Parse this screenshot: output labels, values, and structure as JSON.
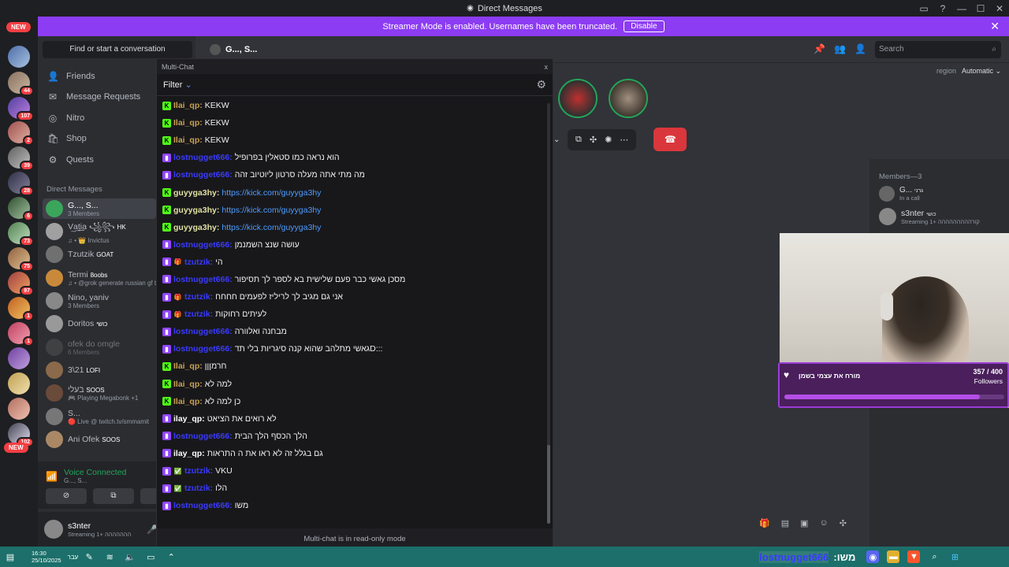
{
  "window": {
    "title": "Direct Messages"
  },
  "banner": {
    "text": "Streamer Mode is enabled. Usernames have been truncated.",
    "button": "Disable"
  },
  "new_badge": "NEW",
  "new_badge_bottom": "NEW",
  "guild_pings": [
    "44",
    "107",
    "2",
    "39",
    "28",
    "6",
    "73",
    "75",
    "97",
    "1",
    "1",
    "102",
    "1"
  ],
  "sidebar": {
    "search": "Find or start a conversation",
    "nav": [
      {
        "label": "Friends",
        "icon": "friends-icon"
      },
      {
        "label": "Message Requests",
        "icon": "envelope-icon"
      },
      {
        "label": "Nitro",
        "icon": "nitro-icon"
      },
      {
        "label": "Shop",
        "icon": "shop-icon"
      },
      {
        "label": "Quests",
        "icon": "quests-icon"
      }
    ],
    "dm_header": "Direct Messages",
    "dms": [
      {
        "name": "G..., S...",
        "sub": "3 Members",
        "color": "#3ba55c"
      },
      {
        "name": "V͢a͢t͢i͢a ꧁꧂",
        "tag": "HK",
        "sub": "♫ • 👑 Invictus",
        "color": "#a0a0a0"
      },
      {
        "name": "Tzutzik",
        "tag": "GOAT",
        "sub": "",
        "color": "#707070"
      },
      {
        "name": "Termi",
        "tag": "8oobs",
        "sub": "♫ • @grok generate russian gf t",
        "color": "#c88a3a"
      },
      {
        "name": "Nino, yaniv",
        "sub": "3 Members",
        "color": "#888"
      },
      {
        "name": "Doritos",
        "tag": "כושי",
        "sub": "",
        "color": "#999"
      },
      {
        "name": "ofek do omgle",
        "sub": "6 Members",
        "color": "#555"
      },
      {
        "name": "3\\21",
        "tag": "LOFI",
        "sub": "",
        "color": "#8a6a4a"
      },
      {
        "name": "בעלי",
        "tag": "SOOS",
        "sub": "🎮 Playing Megabonk +1",
        "color": "#6a4a3a"
      },
      {
        "name": "S...",
        "sub": "🔴 Live @ twitch.tv/smmamit",
        "color": "#777"
      },
      {
        "name": "Ani Ofek",
        "tag": "SOOS",
        "sub": "",
        "color": "#aa8866"
      }
    ],
    "voice": {
      "status": "Voice Connected",
      "channel": "G..., S..."
    },
    "user": {
      "name": "s3nter",
      "status": "Streaming ההההההה",
      "extra": "+1"
    }
  },
  "header": {
    "title": "G..., S...",
    "search_placeholder": "Search",
    "region_label": "region",
    "region_value": "Automatic"
  },
  "members": {
    "header": "Members—3",
    "list": [
      {
        "name": "G...",
        "tag": "גרני",
        "sub": "In a call"
      },
      {
        "name": "s3nter",
        "tag": "כושי",
        "sub": "Streaming קורההההההההה +1"
      }
    ]
  },
  "multichat": {
    "window_title": "Multi-Chat",
    "close": "x",
    "filter": "Filter",
    "footer": "Multi-chat is in read-only mode",
    "messages": [
      {
        "platform": "kick",
        "user": "Ilai_qp:",
        "color": "#c8a050",
        "text": "KEKW"
      },
      {
        "platform": "kick",
        "user": "Ilai_qp:",
        "color": "#c8a050",
        "text": "KEKW"
      },
      {
        "platform": "kick",
        "user": "Ilai_qp:",
        "color": "#c8a050",
        "text": "KEKW"
      },
      {
        "platform": "twitch",
        "user": "lostnugget666:",
        "color": "#3a3aff",
        "text": "הוא נראה כמו סטאלין בפרופיל"
      },
      {
        "platform": "twitch",
        "user": "lostnugget666:",
        "color": "#3a3aff",
        "text": "מה מתי אתה מעלה סרטון ליוטיוב זהה"
      },
      {
        "platform": "kick",
        "user": "guyyga3hy:",
        "color": "#e0e0a0",
        "text": "https://kick.com/guyyga3hy",
        "link": true
      },
      {
        "platform": "kick",
        "user": "guyyga3hy:",
        "color": "#e0e0a0",
        "text": "https://kick.com/guyyga3hy",
        "link": true
      },
      {
        "platform": "kick",
        "user": "guyyga3hy:",
        "color": "#e0e0a0",
        "text": "https://kick.com/guyyga3hy",
        "link": true
      },
      {
        "platform": "twitch",
        "user": "lostnugget666:",
        "color": "#3a3aff",
        "text": "עושה שנצ השמנמן"
      },
      {
        "platform": "twitch",
        "badge": "🎁",
        "user": "tzutzik:",
        "color": "#3a3aff",
        "text": "הי"
      },
      {
        "platform": "twitch",
        "user": "lostnugget666:",
        "color": "#3a3aff",
        "text": "מסכן גאשי כבר פעם שלישית בא לספר לך תסיפור"
      },
      {
        "platform": "twitch",
        "badge": "🎁",
        "user": "tzutzik:",
        "color": "#3a3aff",
        "text": "אני גם מגיב לך לריליז לפעמים חחחח"
      },
      {
        "platform": "twitch",
        "badge": "🎁",
        "user": "tzutzik:",
        "color": "#3a3aff",
        "text": "לעיתים רחוקות"
      },
      {
        "platform": "twitch",
        "user": "lostnugget666:",
        "color": "#3a3aff",
        "text": "מבחנה ואלוורה"
      },
      {
        "platform": "twitch",
        "user": "lostnugget666:",
        "color": "#3a3aff",
        "text": "גאשי מתלהב שהוא קנה סיגריות בלי תדD:::"
      },
      {
        "platform": "kick",
        "user": "Ilai_qp:",
        "color": "#c8a050",
        "text": "חרמןןן"
      },
      {
        "platform": "kick",
        "user": "Ilai_qp:",
        "color": "#c8a050",
        "text": "למה לא"
      },
      {
        "platform": "kick",
        "user": "Ilai_qp:",
        "color": "#c8a050",
        "text": "כן למה לא"
      },
      {
        "platform": "twitch",
        "user": "ilay_qp:",
        "color": "#ffffff",
        "text": "לא רואים את הציאט"
      },
      {
        "platform": "twitch",
        "user": "lostnugget666:",
        "color": "#3a3aff",
        "text": "הלך הכסף הלך הבית"
      },
      {
        "platform": "twitch",
        "user": "ilay_qp:",
        "color": "#ffffff",
        "text": "גם בגלל זה לא ראו את ה התראות"
      },
      {
        "platform": "twitch",
        "badge": "✅",
        "user": "tzutzik:",
        "color": "#3a3aff",
        "text": "VKU"
      },
      {
        "platform": "twitch",
        "badge": "✅",
        "user": "tzutzik:",
        "color": "#3a3aff",
        "text": "הלו"
      },
      {
        "platform": "twitch",
        "user": "lostnugget666:",
        "color": "#3a3aff",
        "text": "משו"
      }
    ]
  },
  "stream_card": {
    "label": "מורח את עצמי בשמן",
    "count": "357 / 400",
    "unit": "Followers",
    "progress": 0.89
  },
  "taskbar": {
    "time": "16:30",
    "date": "25/10/2025",
    "lang": "עבר",
    "ticker_user": "lostnugget666",
    "ticker_text": ":משו"
  },
  "colors": {
    "accent": "#5865f2",
    "banner": "#8c3cf2",
    "kick": "#53fc18",
    "twitch": "#9146ff",
    "hangup": "#da373c"
  }
}
